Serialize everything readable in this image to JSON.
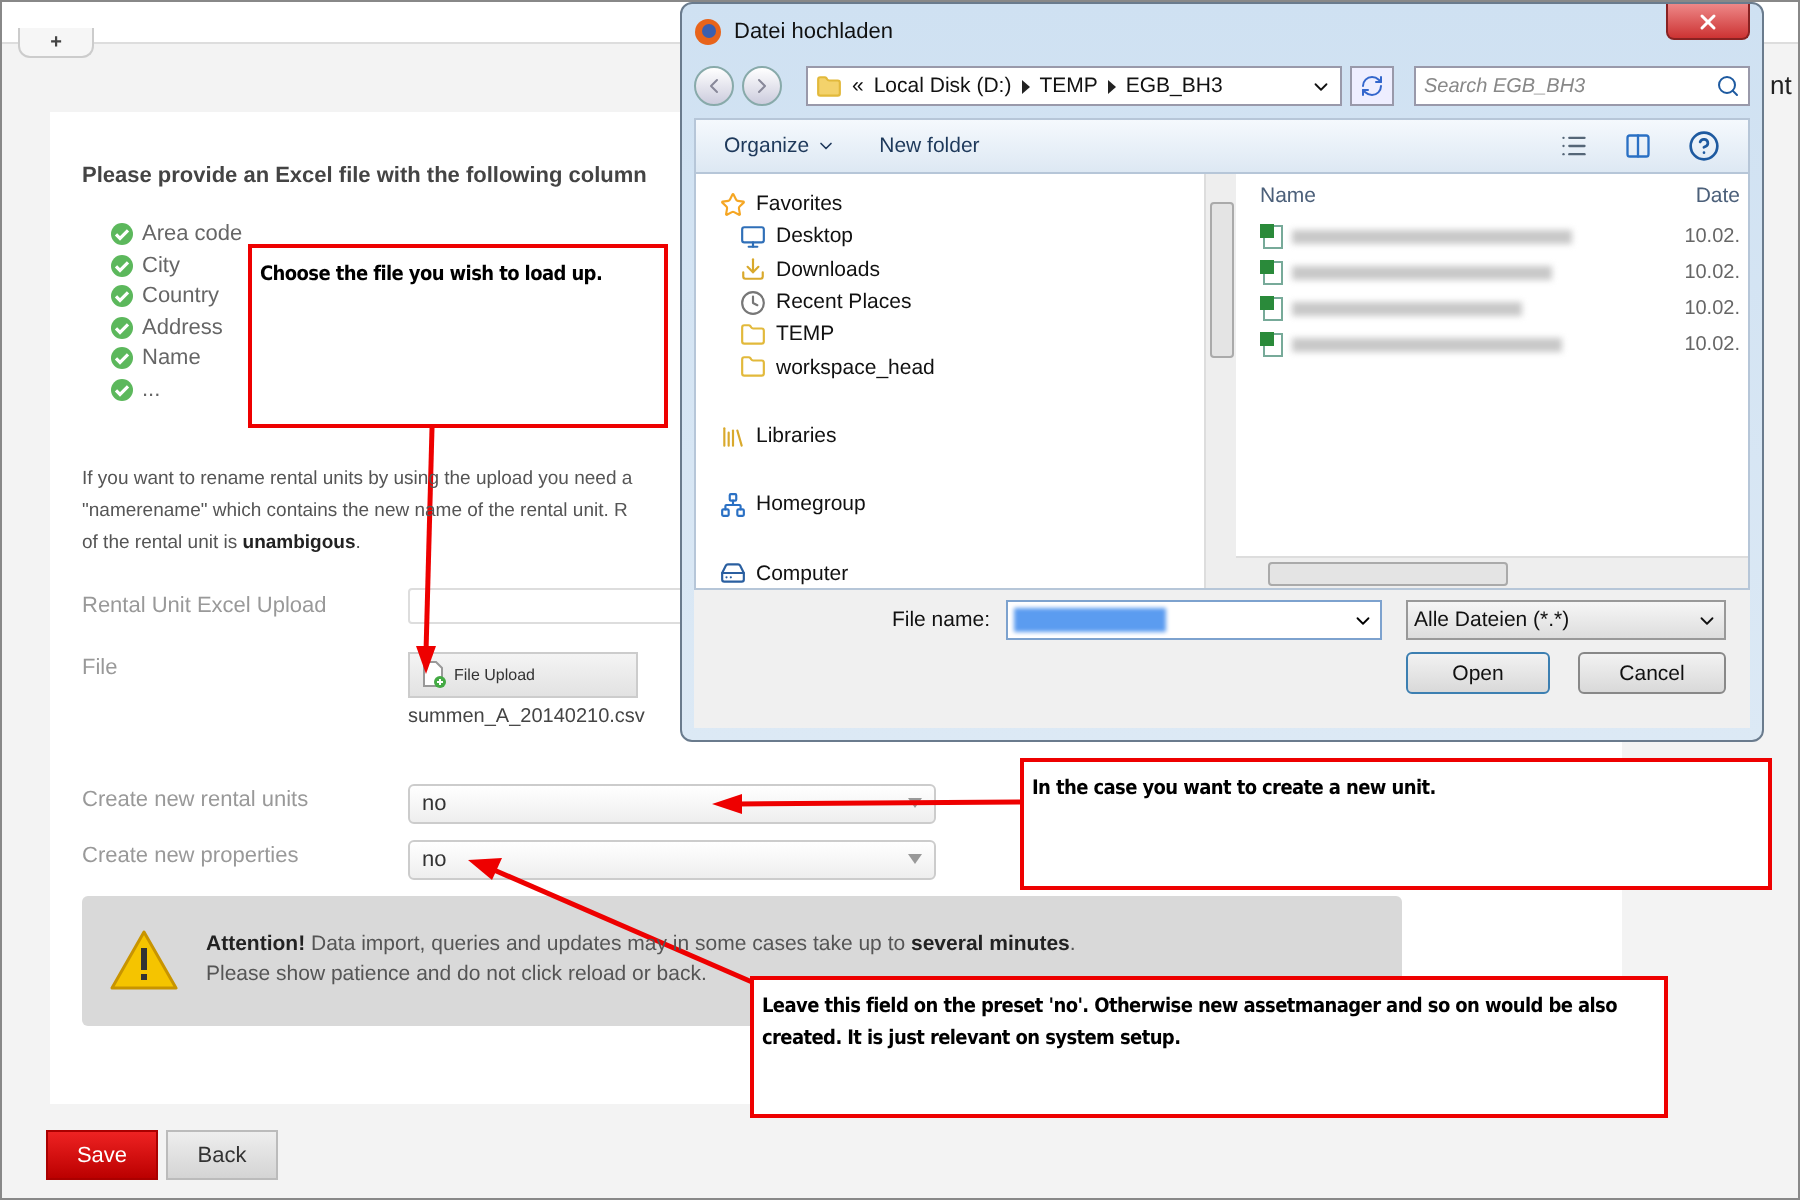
{
  "browser_tab": {
    "label": "+"
  },
  "page": {
    "heading": "Please provide an Excel file with the following column",
    "columns": [
      {
        "label": "Area code",
        "checked": true
      },
      {
        "label": "City",
        "checked": true
      },
      {
        "label": "Country",
        "checked": true
      },
      {
        "label": "Address",
        "checked": true
      },
      {
        "label": "Name",
        "checked": true
      },
      {
        "label": "...",
        "checked": true
      }
    ],
    "note_lines": [
      "If you want to rename rental units by using the upload you need a",
      "\"namerename\" which contains the new name of the rental unit. R",
      "of the rental unit is **unambigous**."
    ],
    "upload_label": "Rental Unit Excel Upload",
    "file_label": "File",
    "upload_button": "File Upload",
    "file_name": "summen_A_20140210.csv",
    "selects": [
      {
        "label": "Create new rental units",
        "value": "no"
      },
      {
        "label": "Create new properties",
        "value": "no"
      }
    ],
    "attention_lines": [
      "**Attention!** Data import, queries and updates may in some cases take up to **several minutes**.",
      "Please show patience and do not click reload or back."
    ],
    "side_text": "nt"
  },
  "buttons": [
    {
      "label": "Save",
      "kind": "primary"
    },
    {
      "label": "Back",
      "kind": "secondary"
    }
  ],
  "dialog": {
    "title": "Datei hochladen",
    "path": [
      "Local Disk (D:)",
      "TEMP",
      "EGB_BH3"
    ],
    "path_prefix": "«",
    "search": {
      "placeholder": "Search EGB_BH3"
    },
    "toolbar": [
      "Organize",
      "New folder"
    ],
    "nav": [
      {
        "label": "Favorites",
        "kind": "star",
        "children": [
          {
            "label": "Desktop",
            "kind": "desktop"
          },
          {
            "label": "Downloads",
            "kind": "download"
          },
          {
            "label": "Recent Places",
            "kind": "recent"
          },
          {
            "label": "TEMP",
            "kind": "folder"
          },
          {
            "label": "workspace_head",
            "kind": "folder"
          }
        ]
      },
      {
        "label": "Libraries",
        "kind": "library"
      },
      {
        "label": "Homegroup",
        "kind": "homegroup"
      },
      {
        "label": "Computer",
        "kind": "computer"
      }
    ],
    "columns": [
      "Name",
      "Date"
    ],
    "files": [
      {
        "date": "10.02."
      },
      {
        "date": "10.02."
      },
      {
        "date": "10.02."
      },
      {
        "date": "10.02."
      }
    ],
    "file_name_label": "File name:",
    "file_type": "Alle Dateien (*.*)",
    "buttons": [
      "Open",
      "Cancel"
    ]
  },
  "callouts": [
    "Choose the file you wish to load up.",
    "In the case you want to create a new unit.",
    "Leave this field on the preset 'no'. Otherwise new assetmanager and so on would be also created. It is just relevant on system setup."
  ]
}
